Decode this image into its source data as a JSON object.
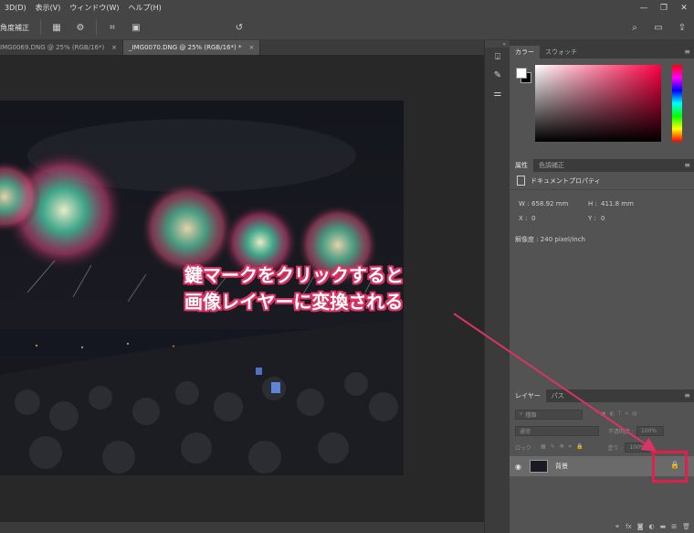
{
  "menu": {
    "items": [
      "3D(D)",
      "表示(V)",
      "ウィンドウ(W)",
      "ヘルプ(H)"
    ]
  },
  "options_bar": {
    "straighten_label": "角度補正"
  },
  "document_tabs": [
    {
      "label": "IMG0069.DNG @ 25% (RGB/16*)",
      "close": "×",
      "active": false
    },
    {
      "label": "_IMG0070.DNG @ 25% (RGB/16*) *",
      "close": "×",
      "active": true
    }
  ],
  "color_panel": {
    "tabs": [
      "カラー",
      "スウォッチ"
    ],
    "foreground": "#ffffff",
    "background": "#000000"
  },
  "properties_panel": {
    "tabs": [
      "属性",
      "色調補正"
    ],
    "section_title": "ドキュメントプロパティ",
    "w_label": "W :",
    "w_value": "658.92 mm",
    "h_label": "H :",
    "h_value": "411.8 mm",
    "x_label": "X :",
    "x_value": "0",
    "y_label": "Y :",
    "y_value": "0",
    "resolution": "解像度 : 240 pixel/inch"
  },
  "layers_panel": {
    "tabs": [
      "レイヤー",
      "パス"
    ],
    "filter_placeholder": "種類",
    "blend_mode": "通常",
    "opacity_label": "不透明度 :",
    "opacity_value": "100%",
    "lock_label": "ロック :",
    "fill_label": "塗り :",
    "fill_value": "100%",
    "layer": {
      "name": "背景",
      "locked": true
    }
  },
  "annotation": {
    "line1": "鍵マークをクリックすると",
    "line2": "画像レイヤーに変換される",
    "color": "#d93463"
  }
}
